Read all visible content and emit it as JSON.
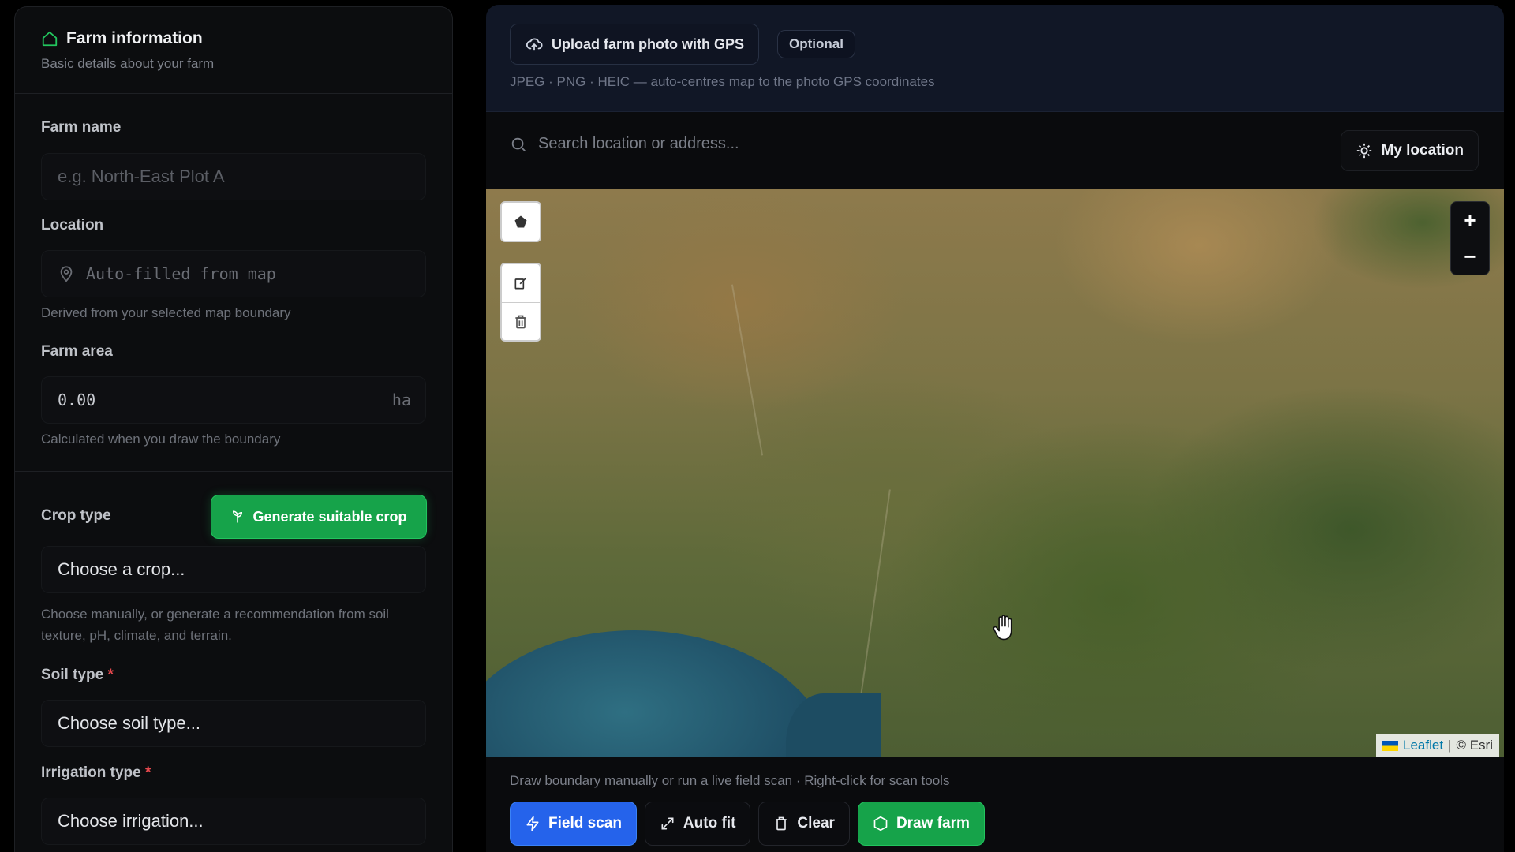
{
  "farm_info": {
    "title": "Farm information",
    "subtitle": "Basic details about your farm",
    "icon": "house-icon"
  },
  "farm_name": {
    "label": "Farm name",
    "placeholder": "e.g. North-East Plot A"
  },
  "location": {
    "label": "Location",
    "placeholder": "Auto-filled from map",
    "help": "Derived from your selected map boundary"
  },
  "farm_area": {
    "label": "Farm area",
    "value": "0.00",
    "unit": "ha",
    "help": "Calculated when you draw the boundary"
  },
  "crop": {
    "label": "Crop type",
    "generate_label": "Generate suitable crop",
    "select_value": "Choose a crop...",
    "help": "Choose manually, or generate a recommendation from soil texture, pH, climate, and terrain."
  },
  "soil": {
    "label": "Soil type",
    "required": "*",
    "select_value": "Choose soil type..."
  },
  "irrigation": {
    "label": "Irrigation type",
    "required": "*",
    "select_value": "Choose irrigation..."
  },
  "upload": {
    "button_label": "Upload farm photo with GPS",
    "badge": "Optional",
    "help": "JPEG · PNG · HEIC — auto-centres map to the photo GPS coordinates"
  },
  "search": {
    "placeholder": "Search location or address...",
    "my_location_label": "My location"
  },
  "map": {
    "zoom_in": "+",
    "zoom_out": "−",
    "attribution_leaflet": "Leaflet",
    "attribution_sep": "|",
    "attribution_esri": "© Esri",
    "help": "Draw boundary manually or run a live field scan · Right-click for scan tools"
  },
  "actions": {
    "field_scan": "Field scan",
    "auto_fit": "Auto fit",
    "clear": "Clear",
    "draw_farm": "Draw farm"
  },
  "colors": {
    "accent_green": "#16a34a",
    "accent_blue": "#2563eb",
    "required_red": "#e5484d"
  }
}
